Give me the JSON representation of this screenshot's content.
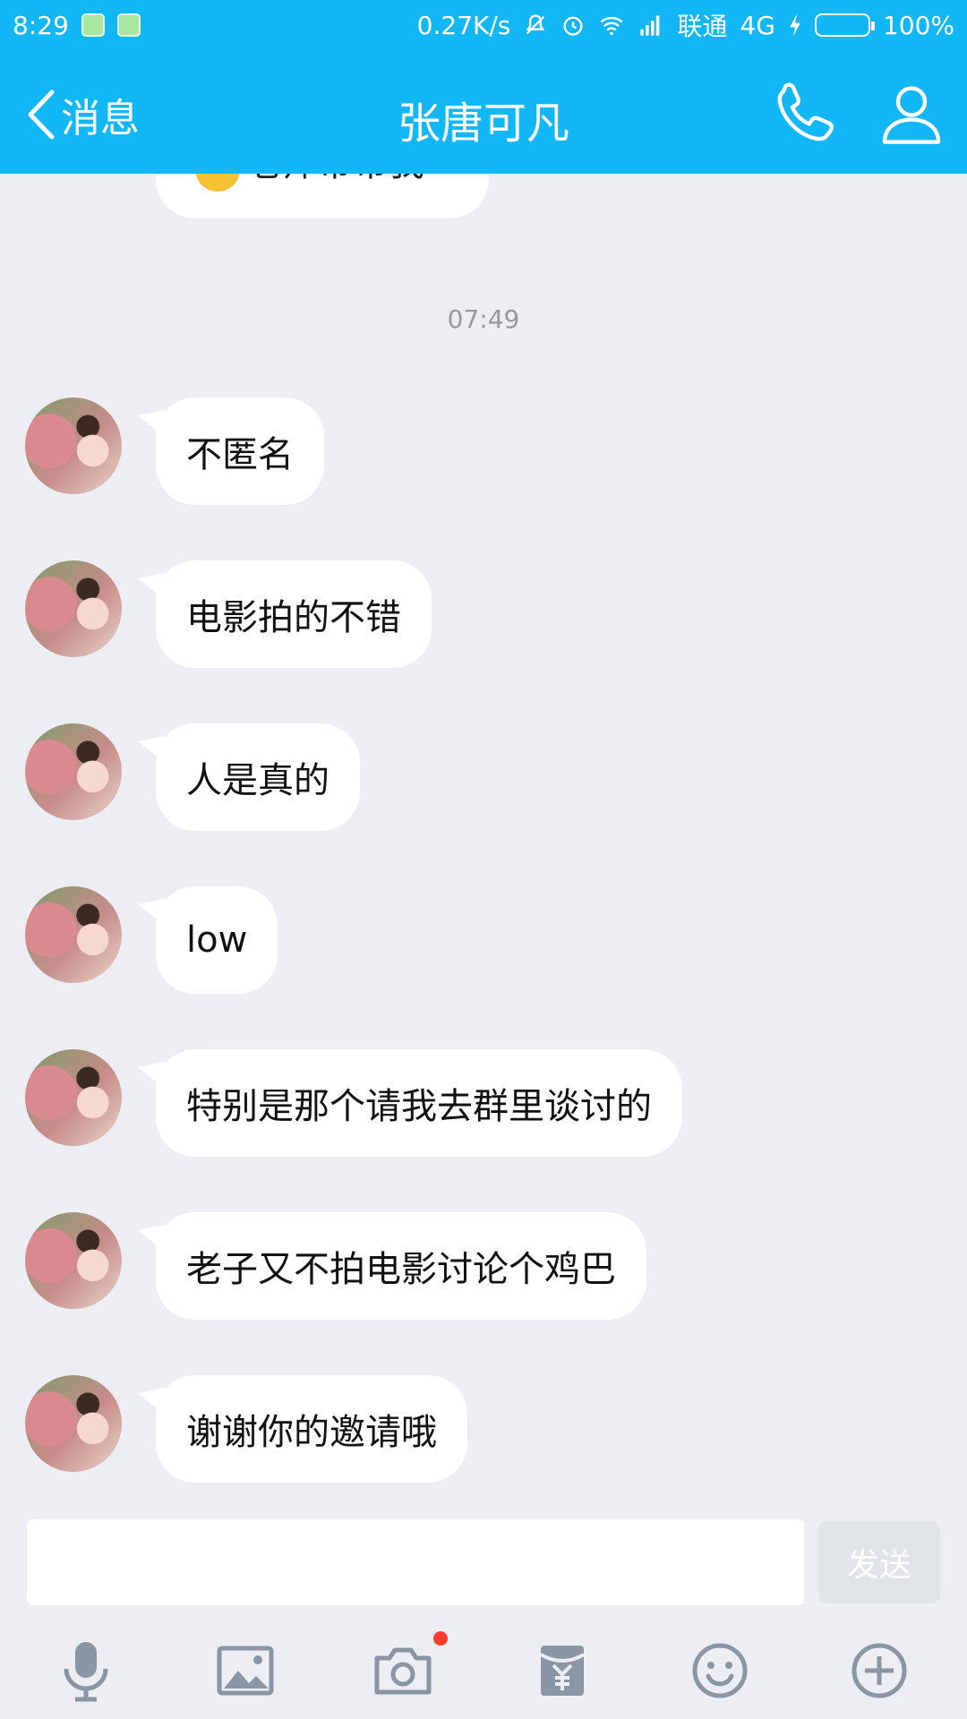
{
  "status_bar": {
    "time": "8:29",
    "network_speed": "0.27K/s",
    "carrier": "联通",
    "network_type": "4G",
    "battery": "100%"
  },
  "header": {
    "back_label": "消息",
    "title": "张唐可凡",
    "accent_color": "#12b7f5"
  },
  "chat": {
    "partial_message": "老师带带我",
    "timestamp": "07:49",
    "messages": [
      {
        "text": "不匿名"
      },
      {
        "text": "电影拍的不错"
      },
      {
        "text": "人是真的"
      },
      {
        "text": "low"
      },
      {
        "text": "特别是那个请我去群里谈讨的"
      },
      {
        "text": "老子又不拍电影讨论个鸡巴"
      },
      {
        "text": "谢谢你的邀请哦"
      }
    ]
  },
  "input": {
    "value": "",
    "placeholder": "",
    "send_label": "发送"
  },
  "toolbar": {
    "icons": [
      "microphone-icon",
      "image-icon",
      "camera-icon",
      "red-packet-icon",
      "emoji-icon",
      "plus-icon"
    ]
  }
}
